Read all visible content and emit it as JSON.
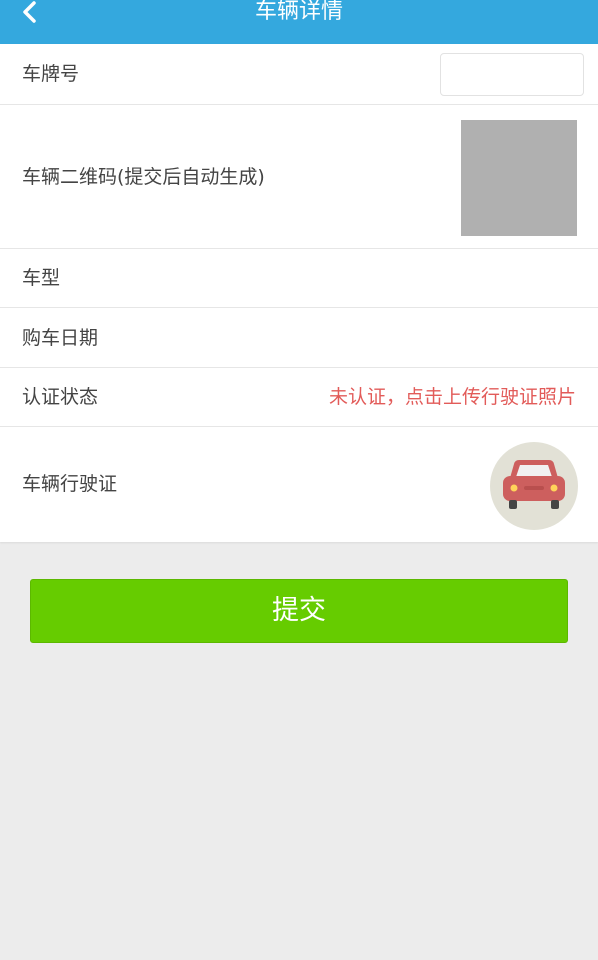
{
  "header": {
    "title": "车辆详情",
    "back_icon": "chevron-left-icon"
  },
  "colors": {
    "header_bg": "#34a8de",
    "status_text": "#e25b59",
    "submit_bg": "#66cc00",
    "page_bg": "#ececec"
  },
  "form": {
    "plate": {
      "label": "车牌号",
      "value": "",
      "placeholder": ""
    },
    "qrcode": {
      "label": "车辆二维码(提交后自动生成)"
    },
    "model": {
      "label": "车型",
      "value": ""
    },
    "purchase_date": {
      "label": "购车日期",
      "value": ""
    },
    "auth_status": {
      "label": "认证状态",
      "value": "未认证，点击上传行驶证照片"
    },
    "license": {
      "label": "车辆行驶证",
      "icon": "car-icon"
    }
  },
  "actions": {
    "submit_label": "提交"
  }
}
